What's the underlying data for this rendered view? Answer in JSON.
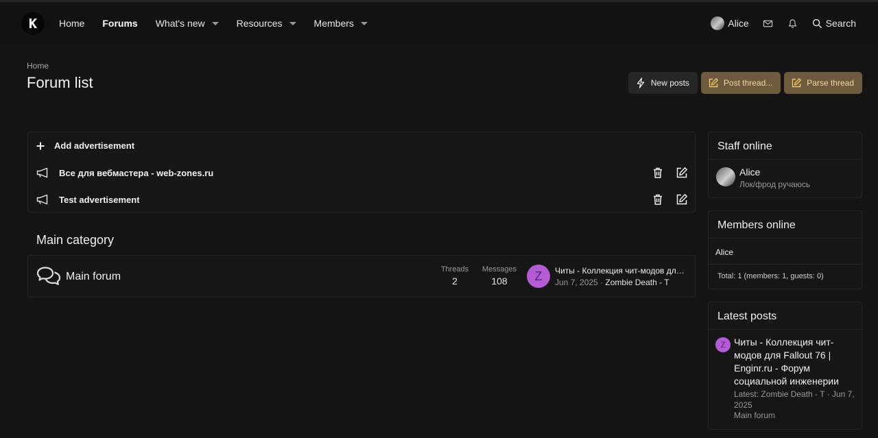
{
  "header": {
    "logo_icon": "k-logo-icon",
    "nav": [
      {
        "label": "Home",
        "active": false,
        "dropdown": false
      },
      {
        "label": "Forums",
        "active": true,
        "dropdown": false
      },
      {
        "label": "What's new",
        "active": false,
        "dropdown": true
      },
      {
        "label": "Resources",
        "active": false,
        "dropdown": true
      },
      {
        "label": "Members",
        "active": false,
        "dropdown": true
      }
    ],
    "user": "Alice",
    "search_label": "Search"
  },
  "breadcrumb": "Home",
  "page_title": "Forum list",
  "actions": {
    "new_posts": "New posts",
    "post_thread": "Post thread...",
    "parse_thread": "Parse thread"
  },
  "ads": {
    "add_label": "Add advertisement",
    "items": [
      {
        "label": "Все для вебмастера - web-zones.ru"
      },
      {
        "label": "Test advertisement"
      }
    ]
  },
  "category": {
    "title": "Main category",
    "forums": [
      {
        "name": "Main forum",
        "threads_label": "Threads",
        "threads": "2",
        "messages_label": "Messages",
        "messages": "108",
        "last_avatar_letter": "Z",
        "last_title": "Читы - Коллекция чит-модов для Fallout 76 | Enginr.ru - Форум социальной инженерии",
        "last_date": "Jun 7, 2025",
        "last_sep": "·",
        "last_user": "Zombie Death - T"
      }
    ]
  },
  "sidebar": {
    "staff": {
      "title": "Staff online",
      "name": "Alice",
      "user_title": "Лок/фрод ручаюсь"
    },
    "members": {
      "title": "Members online",
      "list": "Alice",
      "total": "Total: 1 (members: 1, guests: 0)"
    },
    "latest": {
      "title": "Latest posts",
      "avatar_letter": "Z",
      "post_title": "Читы - Коллекция чит-модов для Fallout 76 | Enginr.ru - Форум социальной инженерии",
      "meta": "Latest: Zombie Death - T · Jun 7, 2025",
      "forum": "Main forum"
    }
  },
  "colors": {
    "background": "#141414",
    "header": "#121212",
    "gold_button": "#6e5a3c",
    "gold_text": "#f1d9a8",
    "avatar_purple": "#b45bd6"
  }
}
